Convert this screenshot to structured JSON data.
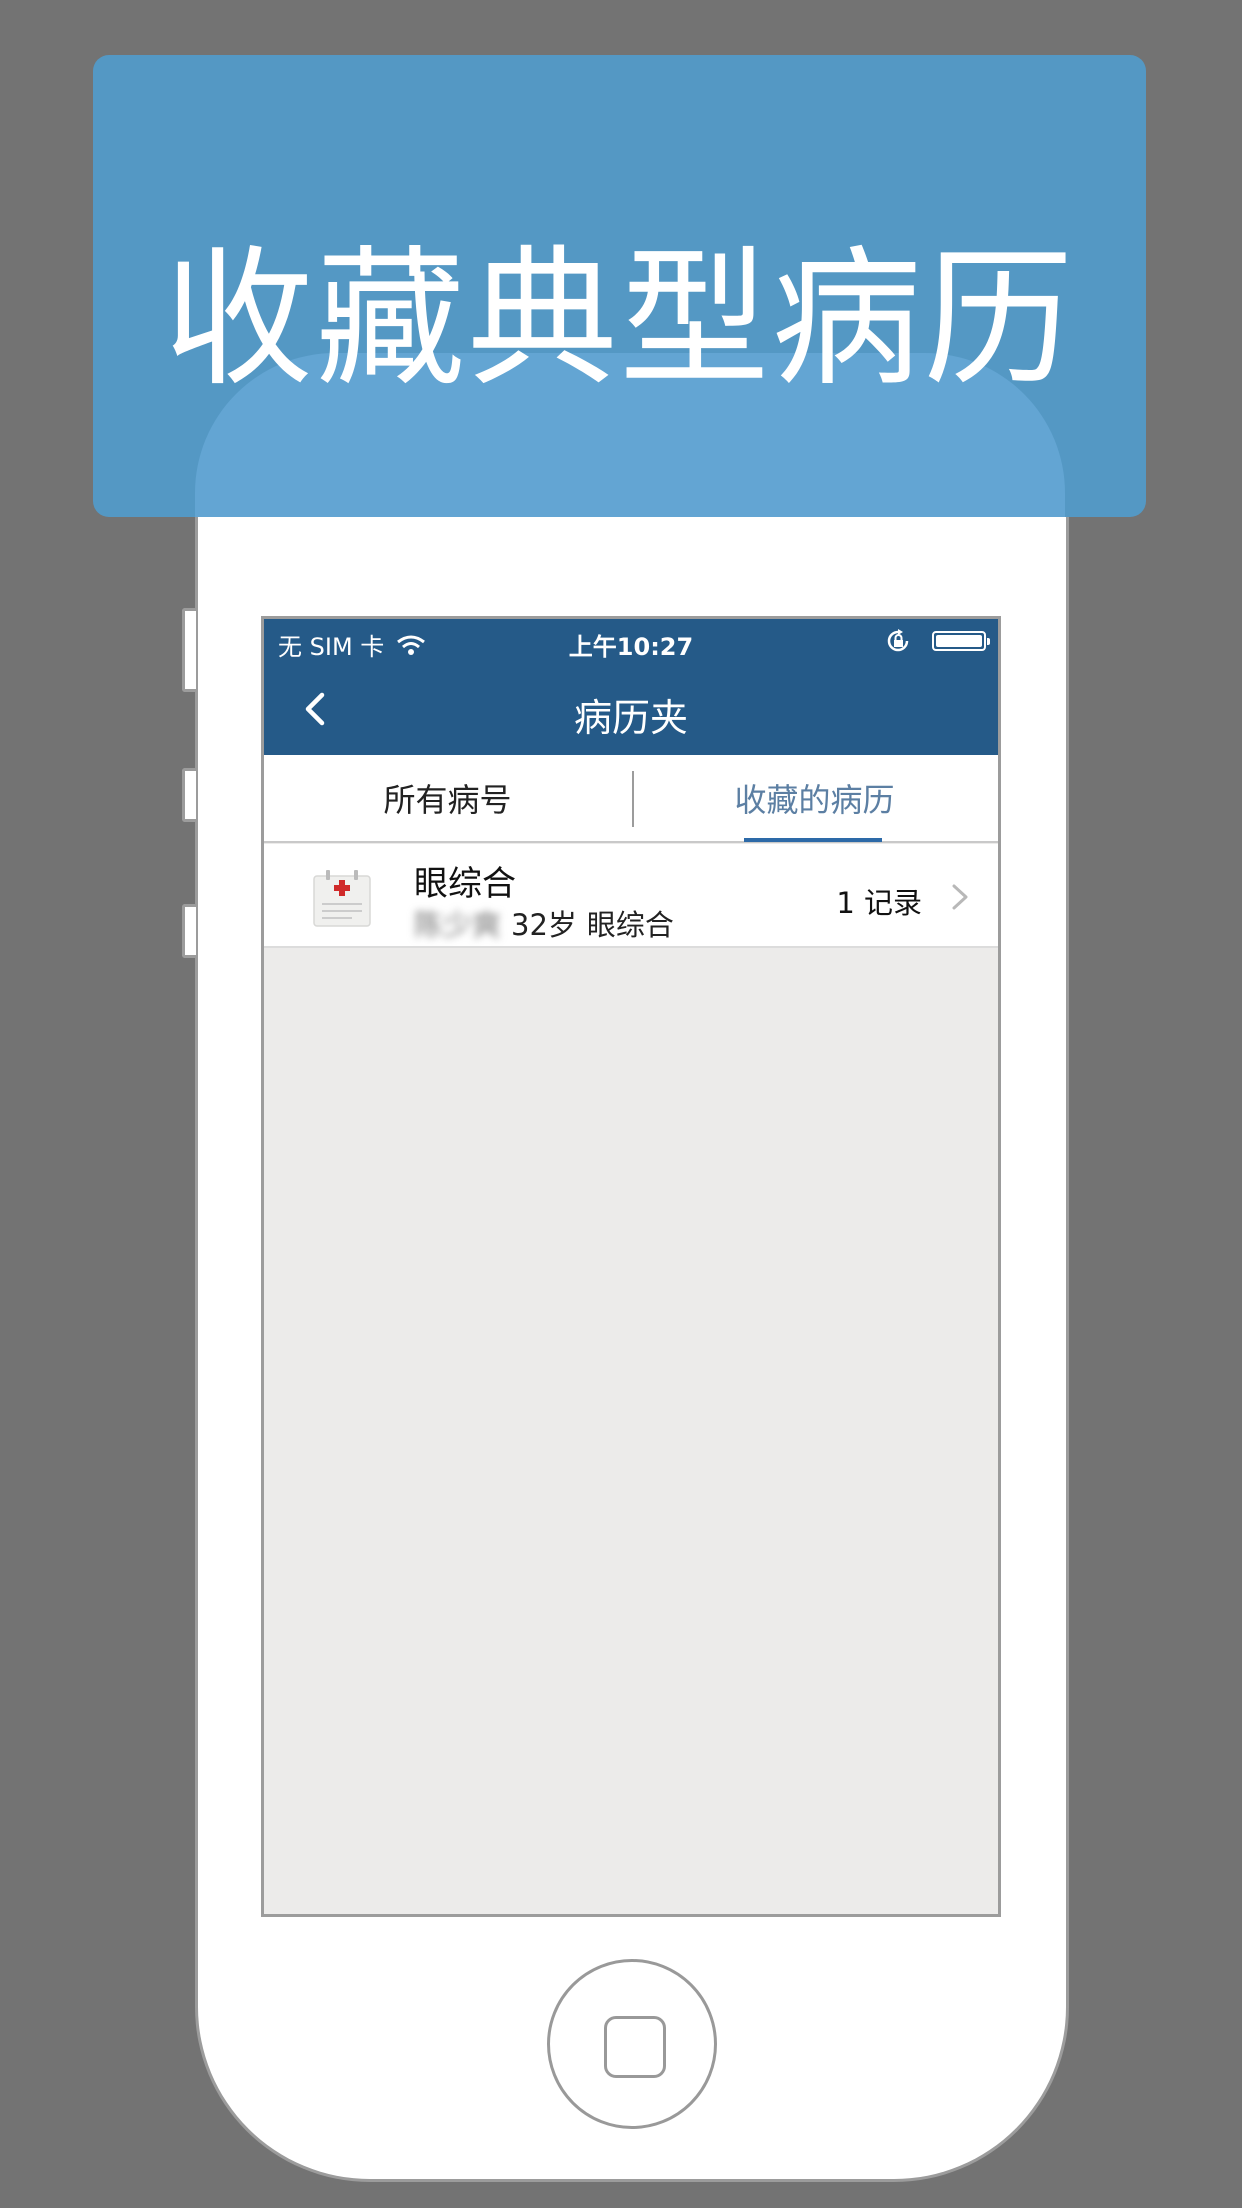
{
  "banner": {
    "title": "收藏典型病历"
  },
  "statusbar": {
    "carrier": "无 SIM 卡",
    "time": "上午10:27"
  },
  "navbar": {
    "title": "病历夹"
  },
  "tabs": [
    {
      "label": "所有病号",
      "active": false
    },
    {
      "label": "收藏的病历",
      "active": true
    }
  ],
  "records": [
    {
      "title": "眼综合",
      "patient_name": "陈少爽",
      "age": "32岁",
      "category": "眼综合",
      "count": "1 记录"
    }
  ],
  "colors": {
    "background": "#737373",
    "banner": "#5498c4",
    "navbar": "#255a88",
    "tab_active": "#5c7fa3",
    "tab_underline": "#2d6aa8",
    "screen_bg": "#ecebea"
  }
}
